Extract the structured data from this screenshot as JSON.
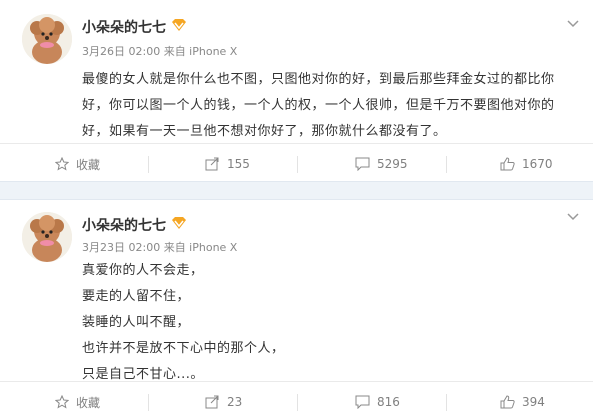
{
  "posts": [
    {
      "username": "小朵朵的七七",
      "meta": "3月26日 02:00 来自 iPhone X",
      "content_lines": [
        "最傻的女人就是你什么也不图，只图他对你的好，到最后那些拜金女过的都比你",
        "好，你可以图一个人的钱，一个人的权，一个人很帅，但是千万不要图他对你的",
        "好，如果有一天一旦他不想对你好了，那你就什么都没有了。"
      ],
      "actions": {
        "favorite": "收藏",
        "repost": "155",
        "comment": "5295",
        "like": "1670"
      }
    },
    {
      "username": "小朵朵的七七",
      "meta": "3月23日 02:00 来自 iPhone X",
      "content_lines": [
        "真爱你的人不会走，",
        "要走的人留不住，",
        "装睡的人叫不醒，",
        "也许并不是放不下心中的那个人，",
        "只是自己不甘心...。"
      ],
      "actions": {
        "favorite": "收藏",
        "repost": "23",
        "comment": "816",
        "like": "394"
      }
    }
  ],
  "colors": {
    "text": "#333333",
    "meta": "#888888",
    "action": "#808080",
    "separator": "#eef3f8",
    "vip_badge": "#f5a623"
  },
  "icons": [
    "avatar",
    "vip-badge-icon",
    "chevron-down-icon",
    "star-icon",
    "repost-icon",
    "comment-icon",
    "like-icon"
  ]
}
